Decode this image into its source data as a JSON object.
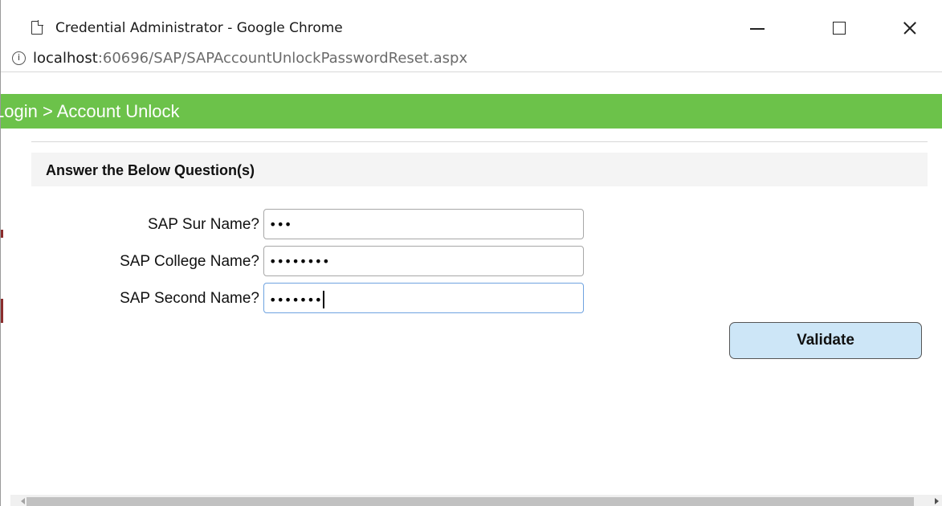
{
  "window": {
    "title": "Credential Administrator - Google Chrome"
  },
  "address": {
    "host": "localhost",
    "path": ":60696/SAP/SAPAccountUnlockPasswordReset.aspx"
  },
  "header": {
    "breadcrumb": "Login > Account Unlock"
  },
  "section": {
    "title": "Answer the Below Question(s)"
  },
  "questions": [
    {
      "label": "SAP Sur Name?",
      "masked_value": "•••"
    },
    {
      "label": "SAP College Name?",
      "masked_value": "••••••••"
    },
    {
      "label": "SAP Second Name?",
      "masked_value": "•••••••"
    }
  ],
  "actions": {
    "validate_label": "Validate"
  },
  "colors": {
    "header_green": "#6cc24a",
    "button_bg": "#cde6f7",
    "focus_border": "#6fa3e0"
  }
}
